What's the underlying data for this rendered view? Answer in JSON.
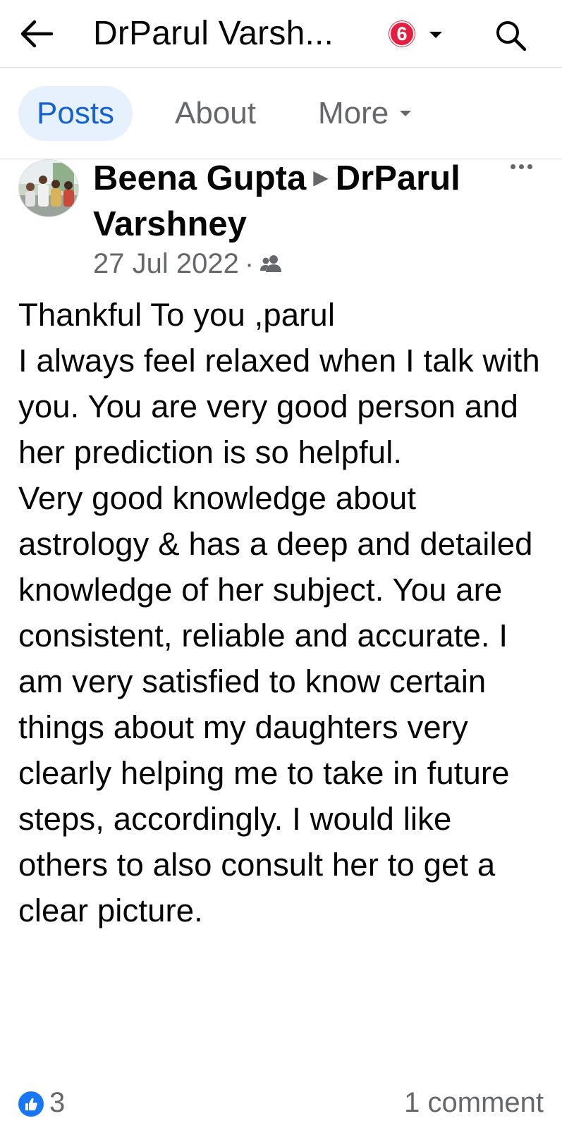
{
  "header": {
    "title": "DrParul Varsh...",
    "notification_count": "6",
    "icons": {
      "back": "back-arrow-icon",
      "caret": "caret-down-icon",
      "search": "search-icon"
    }
  },
  "tabs": [
    {
      "label": "Posts",
      "active": true
    },
    {
      "label": "About",
      "active": false
    },
    {
      "label": "More",
      "active": false
    }
  ],
  "post": {
    "author": "Beena Gupta",
    "recipient": "DrParul Varshney",
    "date": "27 Jul 2022",
    "separator": "·",
    "audience_icon": "friends-icon",
    "body": "Thankful To you ,parul\nI always feel relaxed when I talk with you. You are very good person and her prediction is so helpful.\nVery good knowledge about astrology & has a deep and detailed knowledge of her subject. You are consistent, reliable and accurate. I am very satisfied to know certain things about my daughters very clearly helping me to take in future steps, accordingly. I would like others to also consult her to get a clear picture.",
    "reactions": {
      "count": "3",
      "icon": "like-icon"
    },
    "comments": "1 comment"
  },
  "colors": {
    "accent": "#1463d0",
    "tab_active_bg": "#e7f0fd",
    "badge": "#e41e3f",
    "secondary_text": "#65676b"
  }
}
